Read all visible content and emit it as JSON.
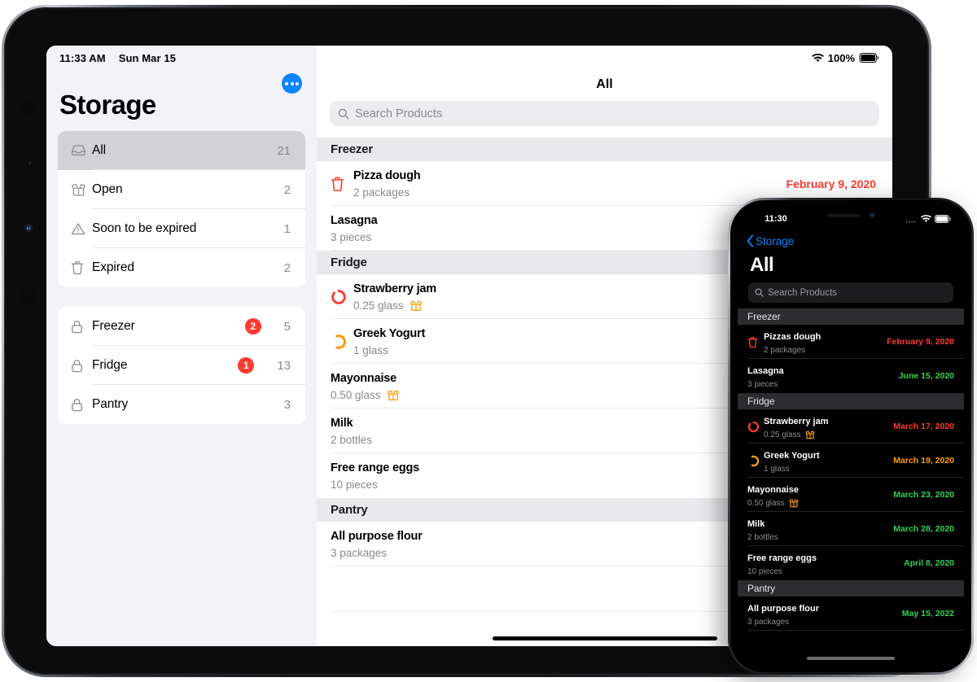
{
  "ipad": {
    "status": {
      "time": "11:33 AM",
      "date": "Sun Mar 15",
      "battery": "100%"
    },
    "sidebar": {
      "title": "Storage",
      "more_label": "More options",
      "group1": [
        {
          "icon": "tray-icon",
          "label": "All",
          "count": "21",
          "selected": true
        },
        {
          "icon": "open-box-icon",
          "label": "Open",
          "count": "2",
          "selected": false
        },
        {
          "icon": "warning-triangle-icon",
          "label": "Soon to be expired",
          "count": "1",
          "selected": false
        },
        {
          "icon": "trash-icon",
          "label": "Expired",
          "count": "2",
          "selected": false
        }
      ],
      "group2": [
        {
          "icon": "lock-icon",
          "label": "Freezer",
          "badge": "2",
          "count": "5"
        },
        {
          "icon": "lock-icon",
          "label": "Fridge",
          "badge": "1",
          "count": "13"
        },
        {
          "icon": "lock-icon",
          "label": "Pantry",
          "badge": "",
          "count": "3"
        }
      ]
    },
    "detail": {
      "nav_title": "All",
      "search_placeholder": "Search Products",
      "sections": [
        {
          "header": "Freezer",
          "items": [
            {
              "icon": "trash-icon",
              "icon_color": "#ff3b30",
              "name": "Pizza dough",
              "qty": "2 packages",
              "open": false,
              "date": "February 9, 2020",
              "date_color": "#ff3b30"
            },
            {
              "icon": "",
              "icon_color": "",
              "name": "Lasagna",
              "qty": "3 pieces",
              "open": false,
              "date": "",
              "date_color": ""
            }
          ]
        },
        {
          "header": "Fridge",
          "items": [
            {
              "icon": "ring-icon",
              "icon_color": "#ff3b30",
              "name": "Strawberry jam",
              "qty": "0.25 glass",
              "open": true,
              "date": "",
              "date_color": ""
            },
            {
              "icon": "ring-icon",
              "icon_color": "#ff9500",
              "name": "Greek Yogurt",
              "qty": "1 glass",
              "open": false,
              "date": "",
              "date_color": ""
            },
            {
              "icon": "",
              "icon_color": "",
              "name": "Mayonnaise",
              "qty": "0.50 glass",
              "open": true,
              "date": "",
              "date_color": ""
            },
            {
              "icon": "",
              "icon_color": "",
              "name": "Milk",
              "qty": "2 bottles",
              "open": false,
              "date": "",
              "date_color": ""
            },
            {
              "icon": "",
              "icon_color": "",
              "name": "Free range eggs",
              "qty": "10 pieces",
              "open": false,
              "date": "",
              "date_color": ""
            }
          ]
        },
        {
          "header": "Pantry",
          "items": [
            {
              "icon": "",
              "icon_color": "",
              "name": "All purpose flour",
              "qty": "3 packages",
              "open": false,
              "date": "",
              "date_color": ""
            }
          ]
        }
      ]
    }
  },
  "iphone": {
    "status": {
      "time": "11:30"
    },
    "back_label": "Storage",
    "nav_title": "All",
    "search_placeholder": "Search Products",
    "sections": [
      {
        "header": "Freezer",
        "items": [
          {
            "icon": "trash-icon",
            "icon_color": "#ff3b30",
            "name": "Pizzas dough",
            "qty": "2 packages",
            "open": false,
            "date": "February 9, 2020",
            "date_color": "#ff3b30"
          },
          {
            "icon": "",
            "icon_color": "",
            "name": "Lasagna",
            "qty": "3 pieces",
            "open": false,
            "date": "June 15, 2020",
            "date_color": "#30d158"
          }
        ]
      },
      {
        "header": "Fridge",
        "items": [
          {
            "icon": "ring-icon",
            "icon_color": "#ff3b30",
            "name": "Strawberry jam",
            "qty": "0.25 glass",
            "open": true,
            "date": "March 17, 2020",
            "date_color": "#ff3b30"
          },
          {
            "icon": "ring-icon",
            "icon_color": "#ff9f0a",
            "name": "Greek Yogurt",
            "qty": "1 glass",
            "open": false,
            "date": "March 19, 2020",
            "date_color": "#ff9f0a"
          },
          {
            "icon": "",
            "icon_color": "",
            "name": "Mayonnaise",
            "qty": "0.50 glass",
            "open": true,
            "date": "March 23, 2020",
            "date_color": "#30d158"
          },
          {
            "icon": "",
            "icon_color": "",
            "name": "Milk",
            "qty": "2 bottles",
            "open": false,
            "date": "March 28, 2020",
            "date_color": "#30d158"
          },
          {
            "icon": "",
            "icon_color": "",
            "name": "Free range eggs",
            "qty": "10 pieces",
            "open": false,
            "date": "April 8, 2020",
            "date_color": "#30d158"
          }
        ]
      },
      {
        "header": "Pantry",
        "items": [
          {
            "icon": "",
            "icon_color": "",
            "name": "All purpose flour",
            "qty": "3 packages",
            "open": false,
            "date": "May 15, 2022",
            "date_color": "#30d158"
          }
        ]
      }
    ]
  },
  "colors": {
    "accent_blue": "#0a84ff",
    "expired_red": "#ff3b30",
    "soon_orange": "#ff9500",
    "ok_green": "#30d158",
    "sidebar_bg": "#f2f2f7",
    "selected_row": "#d1d1d6"
  }
}
